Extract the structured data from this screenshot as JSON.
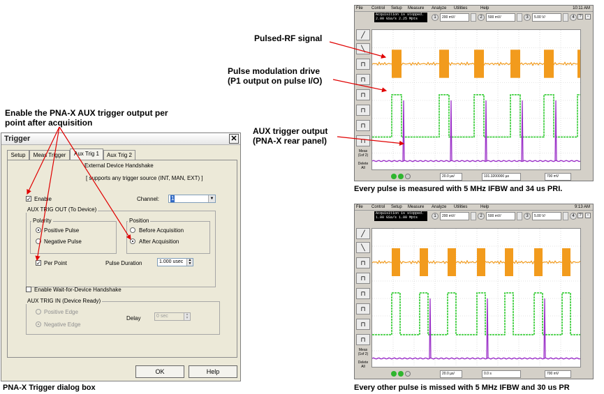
{
  "annotations": {
    "aux_trigger_per_point": "Enable the PNA-X AUX trigger output per point after acquisition",
    "pulsed_rf": "Pulsed-RF signal",
    "pulse_mod_drive": "Pulse modulation drive (P1 output on pulse I/O)",
    "aux_trigger_output": "AUX trigger output (PNA-X rear panel)"
  },
  "captions": {
    "dialog": "PNA-X Trigger dialog box",
    "scope_top": "Every pulse is measured with 5 MHz IFBW and 34 us PRI.",
    "scope_bottom": "Every other pulse is missed with 5 MHz IFBW and 30 us PR"
  },
  "dialog": {
    "title": "Trigger",
    "close_glyph": "✕",
    "tabs": [
      "Setup",
      "Meas Trigger",
      "Aux Trig 1",
      "Aux Trig 2"
    ],
    "handshake_title": "External Device Handshake",
    "handshake_sub": "[ supports any trigger source (INT, MAN, EXT) ]",
    "enable_label": "Enable",
    "enable_checked": true,
    "channel_label": "Channel:",
    "channel_value": "1",
    "aux_out_group": "AUX TRIG OUT (To Device)",
    "polarity_group": "Polarity",
    "positive_pulse": "Positive Pulse",
    "negative_pulse": "Negative Pulse",
    "polarity_selected": "Positive Pulse",
    "position_group": "Position",
    "before_acq": "Before Acquisition",
    "after_acq": "After Acquisition",
    "position_selected": "After Acquisition",
    "per_point_label": "Per Point",
    "per_point_checked": true,
    "pulse_duration_label": "Pulse Duration",
    "pulse_duration_value": "1.000 usec",
    "wait_handshake_label": "Enable Wait-for-Device Handshake",
    "wait_handshake_checked": false,
    "aux_in_group": "AUX TRIG IN (Device Ready)",
    "positive_edge": "Positive Edge",
    "negative_edge": "Negative Edge",
    "edge_selected": "Negative Edge",
    "delay_label": "Delay",
    "delay_value": "0 sec",
    "ok_button": "OK",
    "help_button": "Help"
  },
  "scope_top": {
    "menu": [
      "File",
      "Control",
      "Setup",
      "Measure",
      "Analyze",
      "Utilities",
      "Help"
    ],
    "clock": "10:11 AM",
    "status_lines": [
      "Acquisition is stopped.",
      "2.00 GSa/s  2.25 Mpts"
    ],
    "channels": [
      {
        "num": "1",
        "scale": "200 mV/"
      },
      {
        "num": "2",
        "scale": "500 mV/"
      },
      {
        "num": "3",
        "scale": "5.00 V/"
      },
      {
        "num": "4",
        "scale": ""
      }
    ],
    "side_labels": [
      "Meas (1of 2)",
      "Delete All"
    ],
    "timebase": "20.0 µs/",
    "position": "101.3200000 µs",
    "trigger_level": "700 mV"
  },
  "scope_bottom": {
    "menu": [
      "File",
      "Control",
      "Setup",
      "Measure",
      "Analyze",
      "Utilities",
      "Help"
    ],
    "clock": "9:13 AM",
    "status_lines": [
      "Acquisition is stopped.",
      "1.00 GSa/s  1.00 Mpts"
    ],
    "channels": [
      {
        "num": "1",
        "scale": "200 mV/"
      },
      {
        "num": "2",
        "scale": "500 mV/"
      },
      {
        "num": "3",
        "scale": "5.00 V/"
      },
      {
        "num": "4",
        "scale": ""
      }
    ],
    "side_labels": [
      "Meas (1of 2)",
      "Delete All"
    ],
    "timebase": "20.0 µs/",
    "position": "0.0 s",
    "trigger_level": "700 mV"
  },
  "colors": {
    "rf_trace": "#f29b1d",
    "drive_trace": "#22c722",
    "aux_trace": "#9b30c8",
    "arrow": "#e00000"
  }
}
